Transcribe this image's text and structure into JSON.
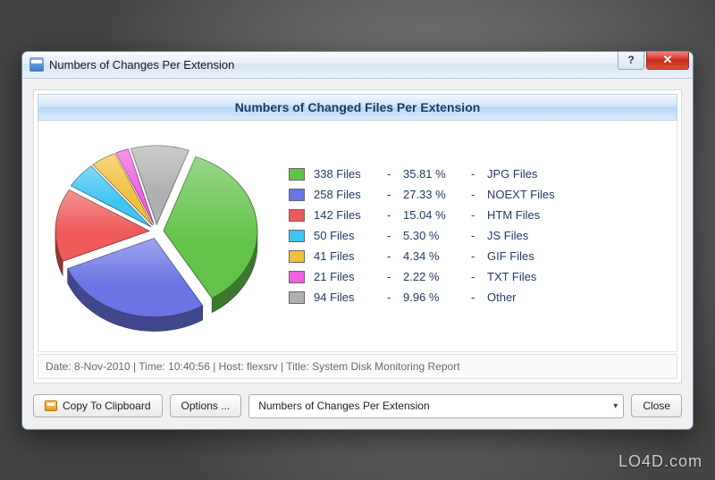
{
  "window": {
    "title": "Numbers of Changes Per Extension"
  },
  "panel": {
    "header": "Numbers of Changed Files Per Extension"
  },
  "chart_data": {
    "type": "pie",
    "title": "Numbers of Changed Files Per Extension",
    "series": [
      {
        "name": "JPG Files",
        "value": 338,
        "percent": 35.81,
        "color": "#62c24a"
      },
      {
        "name": "NOEXT Files",
        "value": 258,
        "percent": 27.33,
        "color": "#6a74e4"
      },
      {
        "name": "HTM Files",
        "value": 142,
        "percent": 15.04,
        "color": "#ef5a5a"
      },
      {
        "name": "JS Files",
        "value": 50,
        "percent": 5.3,
        "color": "#40c4f2"
      },
      {
        "name": "GIF Files",
        "value": 41,
        "percent": 4.34,
        "color": "#f2c040"
      },
      {
        "name": "TXT Files",
        "value": 21,
        "percent": 2.22,
        "color": "#f060e0"
      },
      {
        "name": "Other",
        "value": 94,
        "percent": 9.96,
        "color": "#b0b0b0"
      }
    ]
  },
  "legend": {
    "rows": [
      {
        "swatch": "#62c24a",
        "value": "338 Files",
        "percent": "35.81 %",
        "label": "JPG Files"
      },
      {
        "swatch": "#6a74e4",
        "value": "258 Files",
        "percent": "27.33 %",
        "label": "NOEXT Files"
      },
      {
        "swatch": "#ef5a5a",
        "value": "142 Files",
        "percent": "15.04 %",
        "label": "HTM Files"
      },
      {
        "swatch": "#40c4f2",
        "value": "50 Files",
        "percent": "5.30 %",
        "label": "JS Files"
      },
      {
        "swatch": "#f2c040",
        "value": "41 Files",
        "percent": "4.34 %",
        "label": "GIF Files"
      },
      {
        "swatch": "#f060e0",
        "value": "21 Files",
        "percent": "2.22 %",
        "label": "TXT Files"
      },
      {
        "swatch": "#b0b0b0",
        "value": "94 Files",
        "percent": "9.96 %",
        "label": "Other"
      }
    ]
  },
  "statusbar": {
    "text": "Date: 8-Nov-2010 | Time: 10:40:56 | Host: flexsrv | Title: System Disk Monitoring Report"
  },
  "footer": {
    "copy_label": "Copy To Clipboard",
    "options_label": "Options ...",
    "combo_selected": "Numbers of Changes Per Extension",
    "close_label": "Close"
  },
  "watermark": "LO4D.com"
}
